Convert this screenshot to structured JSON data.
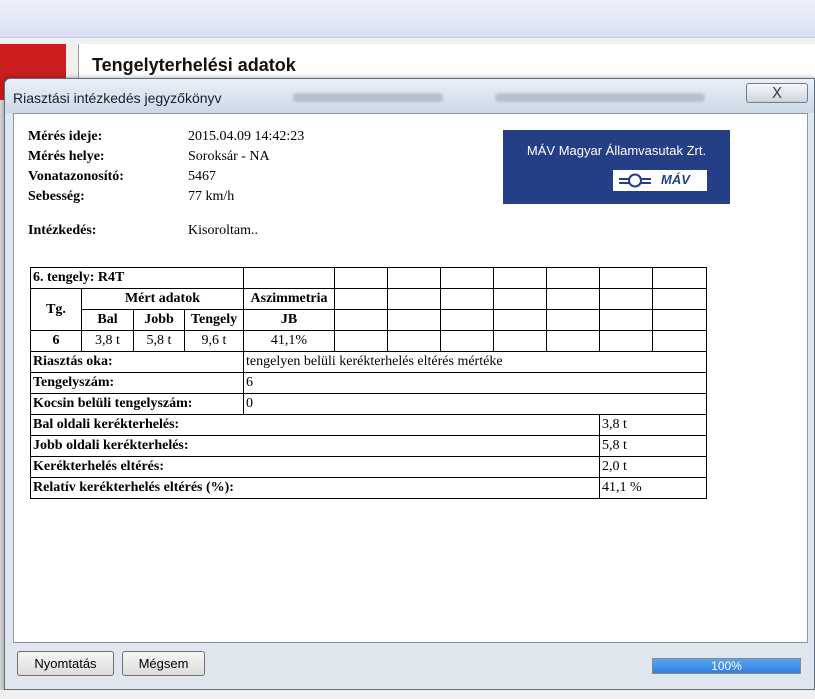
{
  "background": {
    "page_title": "Tengelyterhelési adatok"
  },
  "dialog": {
    "title": "Riasztási intézkedés jegyzőkönyv",
    "close_symbol": "X",
    "info": [
      {
        "label": "Mérés ideje:",
        "value": "2015.04.09 14:42:23"
      },
      {
        "label": "Mérés helye:",
        "value": "Soroksár - NA"
      },
      {
        "label": "Vonatazonosító:",
        "value": "5467"
      },
      {
        "label": "Sebesség:",
        "value": "77 km/h"
      }
    ],
    "action": {
      "label": "Intézkedés:",
      "value": "Kisoroltam.."
    },
    "logo": {
      "text": "MÁV Magyar Államvasutak Zrt.",
      "mark": "MÁV",
      "icon": "mav-railway-logo-icon"
    },
    "axle_table": {
      "title": "6. tengely: R4T",
      "col_tg": "Tg.",
      "group_measured": "Mért adatok",
      "group_asym": "Aszimmetria",
      "sub_bal": "Bal",
      "sub_jobb": "Jobb",
      "sub_tengely": "Tengely",
      "sub_jb": "JB",
      "row": {
        "tg": "6",
        "bal": "3,8 t",
        "jobb": "5,8 t",
        "tengely": "9,6 t",
        "jb": "41,1%"
      }
    },
    "details": [
      {
        "label": "Riasztás oka:",
        "value": "tengelyen belüli kerékterhelés eltérés mértéke"
      },
      {
        "label": "Tengelyszám:",
        "value": "6"
      },
      {
        "label": "Kocsin belüli tengelyszám:",
        "value": "0"
      }
    ],
    "loads": [
      {
        "label": "Bal oldali kerékterhelés:",
        "value": "3,8 t"
      },
      {
        "label": "Jobb oldali kerékterhelés:",
        "value": "5,8 t"
      },
      {
        "label": "Kerékterhelés eltérés:",
        "value": "2,0 t"
      },
      {
        "label": "Relatív kerékterhelés eltérés (%):",
        "value": "41,1 %"
      }
    ],
    "buttons": {
      "print": "Nyomtatás",
      "cancel": "Mégsem"
    },
    "progress": {
      "value": 100,
      "label": "100%"
    }
  },
  "colors": {
    "logo_bg": "#253f86",
    "progress_fill": "#2f7fe0",
    "bg_accent_red": "#cc1e1e"
  }
}
